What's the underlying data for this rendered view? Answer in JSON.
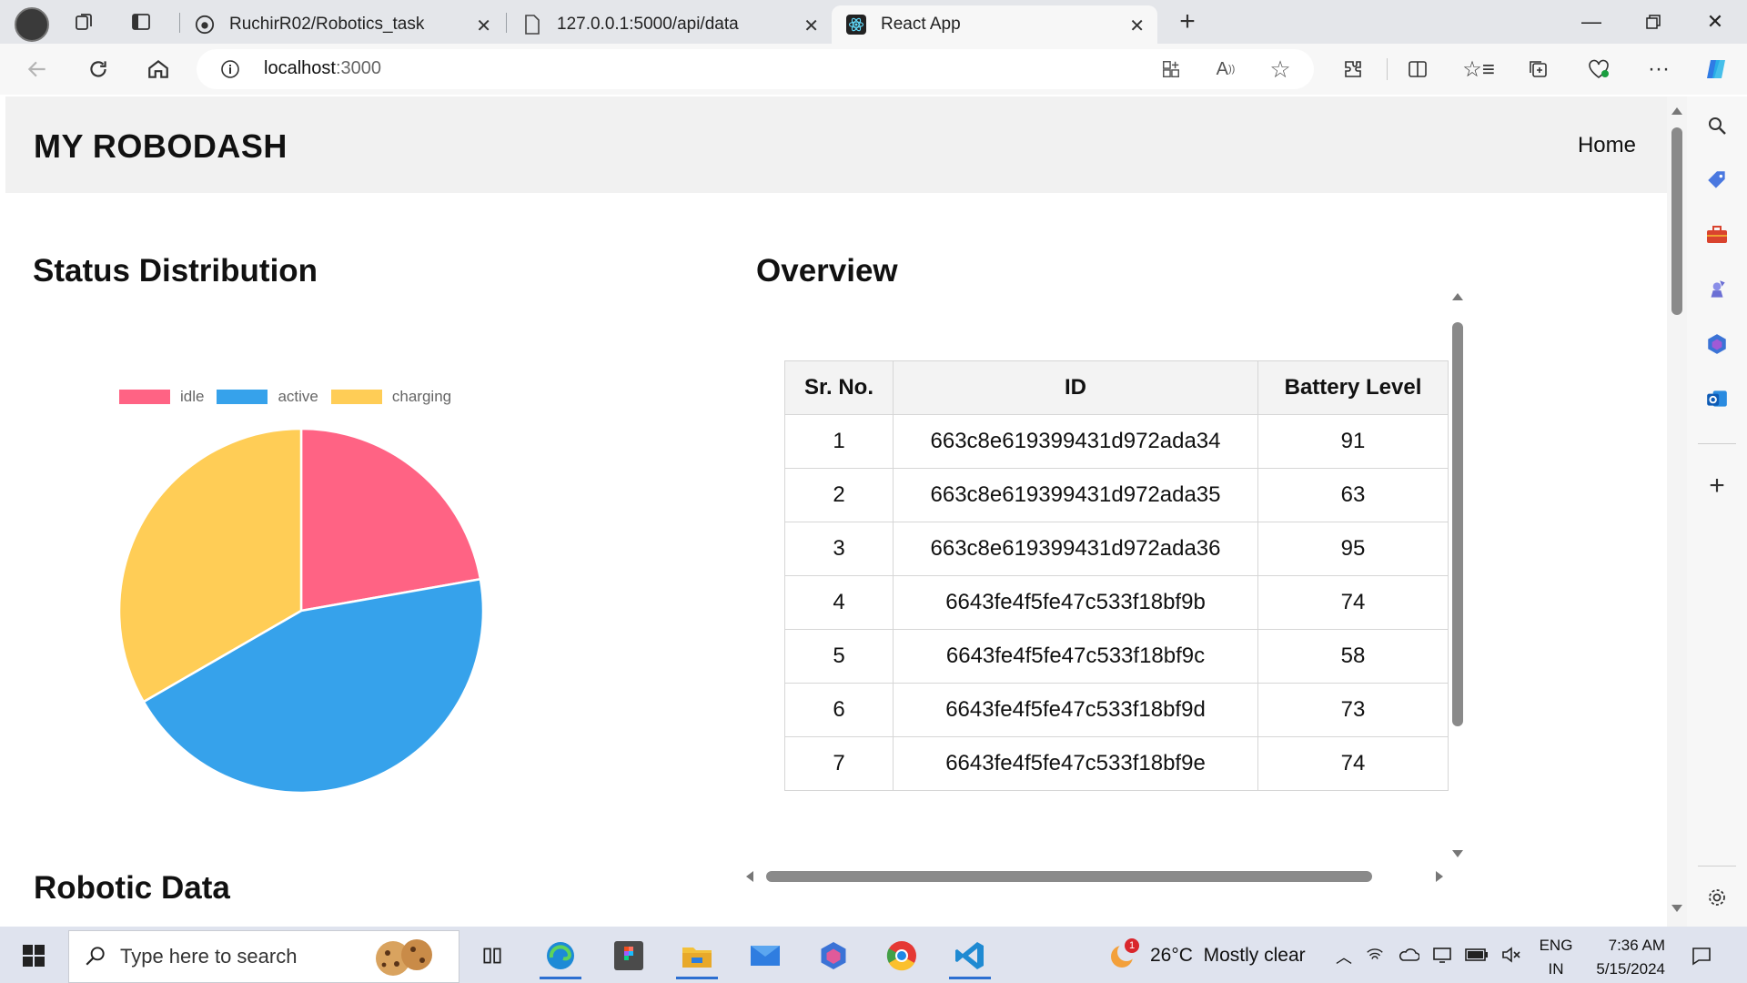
{
  "browser": {
    "tabs": [
      {
        "title": "RuchirR02/Robotics_task",
        "icon": "github-icon"
      },
      {
        "title": "127.0.0.1:5000/api/data",
        "icon": "file-icon"
      },
      {
        "title": "React App",
        "icon": "react-icon",
        "active": true
      }
    ],
    "address": {
      "host": "localhost",
      "port": ":3000"
    }
  },
  "app": {
    "brand": "MY ROBODASH",
    "nav_home": "Home",
    "status_title": "Status Distribution",
    "overview_title": "Overview",
    "robotic_title": "Robotic Data"
  },
  "chart_data": {
    "type": "pie",
    "categories": [
      "idle",
      "active",
      "charging"
    ],
    "values": [
      2,
      4,
      3
    ],
    "colors": [
      "#ff6384",
      "#36a2eb",
      "#ffcd56"
    ],
    "legend_position": "top"
  },
  "table": {
    "headers": [
      "Sr. No.",
      "ID",
      "Battery Level"
    ],
    "rows": [
      [
        "1",
        "663c8e619399431d972ada34",
        "91"
      ],
      [
        "2",
        "663c8e619399431d972ada35",
        "63"
      ],
      [
        "3",
        "663c8e619399431d972ada36",
        "95"
      ],
      [
        "4",
        "6643fe4f5fe47c533f18bf9b",
        "74"
      ],
      [
        "5",
        "6643fe4f5fe47c533f18bf9c",
        "58"
      ],
      [
        "6",
        "6643fe4f5fe47c533f18bf9d",
        "73"
      ],
      [
        "7",
        "6643fe4f5fe47c533f18bf9e",
        "74"
      ]
    ]
  },
  "taskbar": {
    "search_placeholder": "Type here to search",
    "weather": "26°C  Mostly clear",
    "weather_badge": "1",
    "lang_top": "ENG",
    "lang_bottom": "IN",
    "time": "7:36 AM",
    "date": "5/15/2024"
  }
}
